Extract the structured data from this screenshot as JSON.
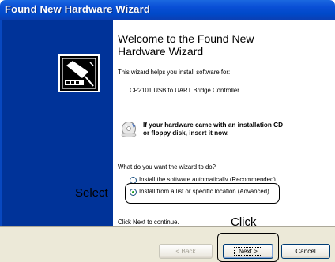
{
  "window": {
    "title": "Found New Hardware Wizard"
  },
  "main": {
    "heading_line1": "Welcome to the Found New",
    "heading_line2": "Hardware Wizard",
    "intro": "This wizard helps you install software for:",
    "device": "CP2101 USB to UART Bridge Controller",
    "cd_prompt_line1": "If your hardware came with an installation CD",
    "cd_prompt_line2": "or floppy disk, insert it now.",
    "question": "What do you want the wizard to do?",
    "option_auto": "Install the software automatically (Recommended)",
    "option_list": "Install from a list or specific location (Advanced)",
    "continue_hint": "Click Next to continue."
  },
  "callouts": {
    "select": "Select",
    "click": "Click"
  },
  "buttons": {
    "back": "< Back",
    "next": "Next >",
    "cancel": "Cancel"
  },
  "colors": {
    "title_bar": "#0a4fd6",
    "left_panel": "#003399",
    "radio_selected": "#21a121"
  }
}
